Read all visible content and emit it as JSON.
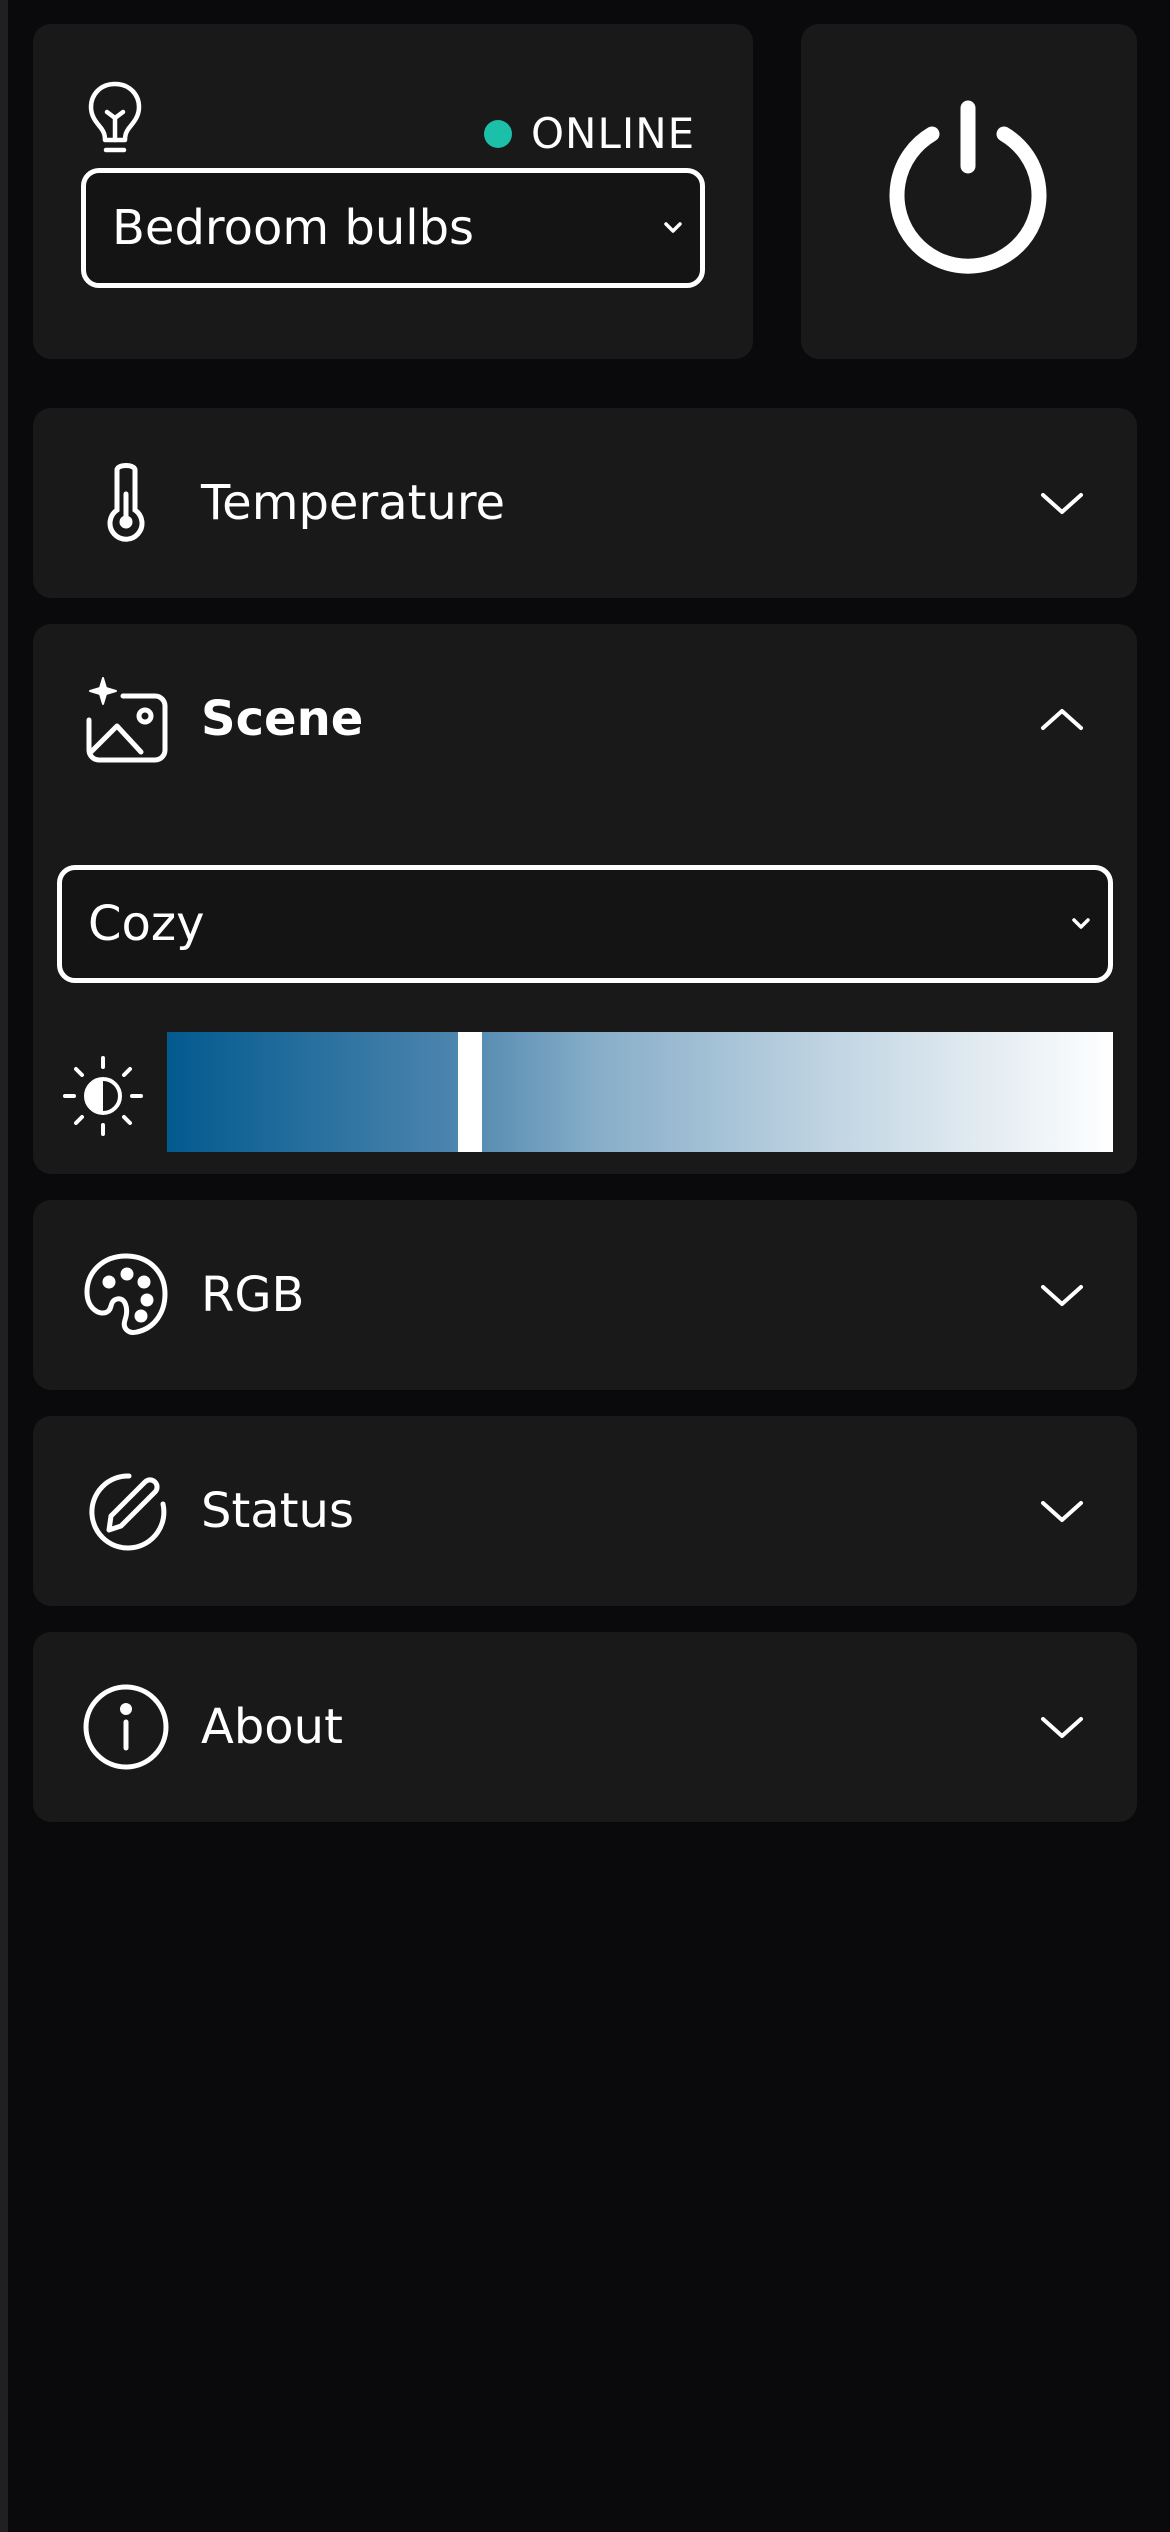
{
  "device": {
    "status": "ONLINE",
    "status_color": "#1cbfa8",
    "selected": "Bedroom bulbs"
  },
  "icons": {
    "bulb": "lightbulb-icon",
    "power": "power-icon",
    "temperature": "thermometer-icon",
    "scene": "image-sparkle-icon",
    "brightness": "brightness-icon",
    "rgb": "palette-icon",
    "status": "edit-circle-icon",
    "about": "info-icon"
  },
  "sections": {
    "temperature": {
      "label": "Temperature",
      "expanded": false
    },
    "scene": {
      "label": "Scene",
      "expanded": true,
      "selected": "Cozy",
      "brightness": 0.32
    },
    "rgb": {
      "label": "RGB",
      "expanded": false
    },
    "status": {
      "label": "Status",
      "expanded": false
    },
    "about": {
      "label": "About",
      "expanded": false
    }
  }
}
